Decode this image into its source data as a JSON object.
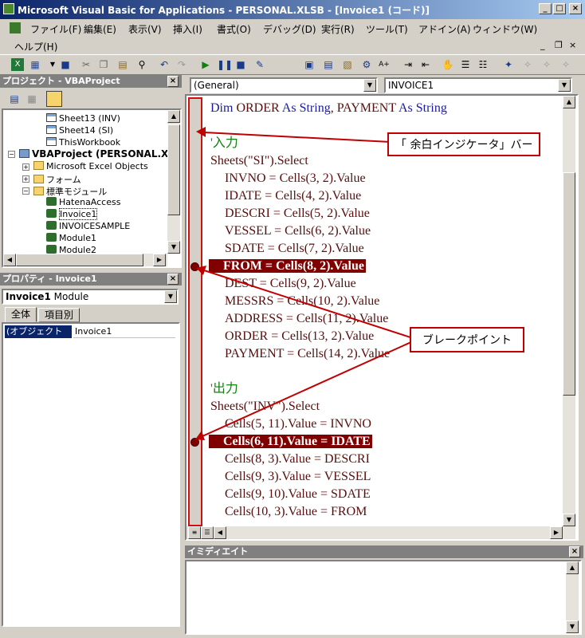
{
  "window": {
    "title": "Microsoft Visual Basic for Applications - PERSONAL.XLSB - [Invoice1 (コード)]",
    "controls": {
      "minimize": "_",
      "restore": "□",
      "close": "×"
    }
  },
  "menu": {
    "items": [
      "ファイル(F)",
      "編集(E)",
      "表示(V)",
      "挿入(I)",
      "書式(O)",
      "デバッグ(D)",
      "実行(R)",
      "ツール(T)",
      "アドイン(A)",
      "ウィンドウ(W)"
    ],
    "help": "ヘルプ(H)",
    "mdi_controls": {
      "minimize": "_",
      "restore": "❐",
      "close": "×"
    }
  },
  "project": {
    "title": "プロジェクト - VBAProject",
    "tree": [
      {
        "label": "Sheet13 (INV)",
        "icon": "sheet-icon"
      },
      {
        "label": "Sheet14 (SI)",
        "icon": "sheet-icon"
      },
      {
        "label": "ThisWorkbook",
        "icon": "workbook-icon"
      },
      {
        "label": "VBAProject (PERSONAL.X",
        "icon": "project-icon"
      },
      {
        "label": "Microsoft Excel Objects",
        "icon": "folder-icon"
      },
      {
        "label": "フォーム",
        "icon": "folder-icon"
      },
      {
        "label": "標準モジュール",
        "icon": "folder-icon"
      },
      {
        "label": "HatenaAccess",
        "icon": "module-icon"
      },
      {
        "label": "Invoice1",
        "icon": "module-icon"
      },
      {
        "label": "INVOICESAMPLE",
        "icon": "module-icon"
      },
      {
        "label": "Module1",
        "icon": "module-icon"
      },
      {
        "label": "Module2",
        "icon": "module-icon"
      }
    ]
  },
  "properties": {
    "title": "プロパティ - Invoice1",
    "object_name": "Invoice1",
    "object_type": "Module",
    "tabs": [
      "全体",
      "項目別"
    ],
    "row": {
      "name": "(オブジェクト名)",
      "value": "Invoice1"
    }
  },
  "code_window": {
    "object_combo": "(General)",
    "proc_combo": "INVOICE1",
    "lines": [
      {
        "segments": [
          {
            "t": "Dim ",
            "c": "kw"
          },
          {
            "t": "ORDER ",
            "c": ""
          },
          {
            "t": "As String",
            "c": "kw"
          },
          {
            "t": ", PAYMENT ",
            "c": ""
          },
          {
            "t": "As String",
            "c": "kw"
          }
        ],
        "indent": 0,
        "breakpoint": false
      },
      {
        "segments": [],
        "indent": 0,
        "breakpoint": false
      },
      {
        "segments": [
          {
            "t": "'入力",
            "c": "cm"
          }
        ],
        "indent": 0,
        "breakpoint": false
      },
      {
        "segments": [
          {
            "t": "Sheets(\"SI\").Select",
            "c": ""
          }
        ],
        "indent": 0,
        "breakpoint": false
      },
      {
        "segments": [
          {
            "t": "INVNO = Cells(3, 2).Value",
            "c": ""
          }
        ],
        "indent": 1,
        "breakpoint": false
      },
      {
        "segments": [
          {
            "t": "IDATE = Cells(4, 2).Value",
            "c": ""
          }
        ],
        "indent": 1,
        "breakpoint": false
      },
      {
        "segments": [
          {
            "t": "DESCRI = Cells(5, 2).Value",
            "c": ""
          }
        ],
        "indent": 1,
        "breakpoint": false
      },
      {
        "segments": [
          {
            "t": "VESSEL = Cells(6, 2).Value",
            "c": ""
          }
        ],
        "indent": 1,
        "breakpoint": false
      },
      {
        "segments": [
          {
            "t": "SDATE = Cells(7, 2).Value",
            "c": ""
          }
        ],
        "indent": 1,
        "breakpoint": false
      },
      {
        "segments": [
          {
            "t": "FROM = Cells(8, 2).Value",
            "c": ""
          }
        ],
        "indent": 1,
        "breakpoint": true
      },
      {
        "segments": [
          {
            "t": "DEST = Cells(9, 2).Value",
            "c": ""
          }
        ],
        "indent": 1,
        "breakpoint": false
      },
      {
        "segments": [
          {
            "t": "MESSRS = Cells(10, 2).Value",
            "c": ""
          }
        ],
        "indent": 1,
        "breakpoint": false
      },
      {
        "segments": [
          {
            "t": "ADDRESS = Cells(11, 2).Value",
            "c": ""
          }
        ],
        "indent": 1,
        "breakpoint": false
      },
      {
        "segments": [
          {
            "t": "ORDER = Cells(13, 2).Value",
            "c": ""
          }
        ],
        "indent": 1,
        "breakpoint": false
      },
      {
        "segments": [
          {
            "t": "PAYMENT = Cells(14, 2).Value",
            "c": ""
          }
        ],
        "indent": 1,
        "breakpoint": false
      },
      {
        "segments": [],
        "indent": 0,
        "breakpoint": false
      },
      {
        "segments": [
          {
            "t": "'出力",
            "c": "cm"
          }
        ],
        "indent": 0,
        "breakpoint": false
      },
      {
        "segments": [
          {
            "t": "Sheets(\"INV\").Select",
            "c": ""
          }
        ],
        "indent": 0,
        "breakpoint": false
      },
      {
        "segments": [
          {
            "t": "Cells(5, 11).Value = INVNO",
            "c": ""
          }
        ],
        "indent": 1,
        "breakpoint": false
      },
      {
        "segments": [
          {
            "t": "Cells(6, 11).Value = IDATE",
            "c": ""
          }
        ],
        "indent": 1,
        "breakpoint": true
      },
      {
        "segments": [
          {
            "t": "Cells(8, 3).Value = DESCRI",
            "c": ""
          }
        ],
        "indent": 1,
        "breakpoint": false
      },
      {
        "segments": [
          {
            "t": "Cells(9, 3).Value = VESSEL",
            "c": ""
          }
        ],
        "indent": 1,
        "breakpoint": false
      },
      {
        "segments": [
          {
            "t": "Cells(9, 10).Value = SDATE",
            "c": ""
          }
        ],
        "indent": 1,
        "breakpoint": false
      },
      {
        "segments": [
          {
            "t": "Cells(10, 3).Value = FROM",
            "c": ""
          }
        ],
        "indent": 1,
        "breakpoint": false
      }
    ]
  },
  "annotations": {
    "margin_bar": "「 余白インジケータ」バー",
    "breakpoint": "ブレークポイント"
  },
  "immediate": {
    "title": "イミディエイト"
  },
  "colors": {
    "titlebar_start": "#0a246a",
    "breakpoint": "#800000",
    "callout_border": "#c00000",
    "keyword": "#1a1aa0",
    "comment": "#108010"
  }
}
